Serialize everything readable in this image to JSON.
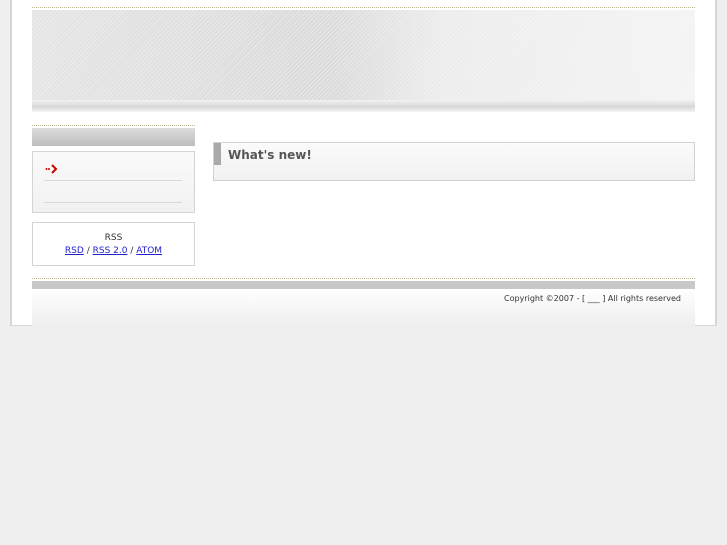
{
  "sidebar": {
    "items": [
      {
        "label": "",
        "icon": "arrow-right-icon",
        "icon_color": "#cc0000"
      },
      {
        "label": ""
      }
    ]
  },
  "rss": {
    "title": "RSS",
    "links": [
      "RSD",
      "RSS 2.0",
      "ATOM"
    ],
    "separator": "/"
  },
  "main": {
    "section_title": "What's new!"
  },
  "footer": {
    "copyright": "Copyright ©2007 - [ ___ ] All rights reserved"
  }
}
